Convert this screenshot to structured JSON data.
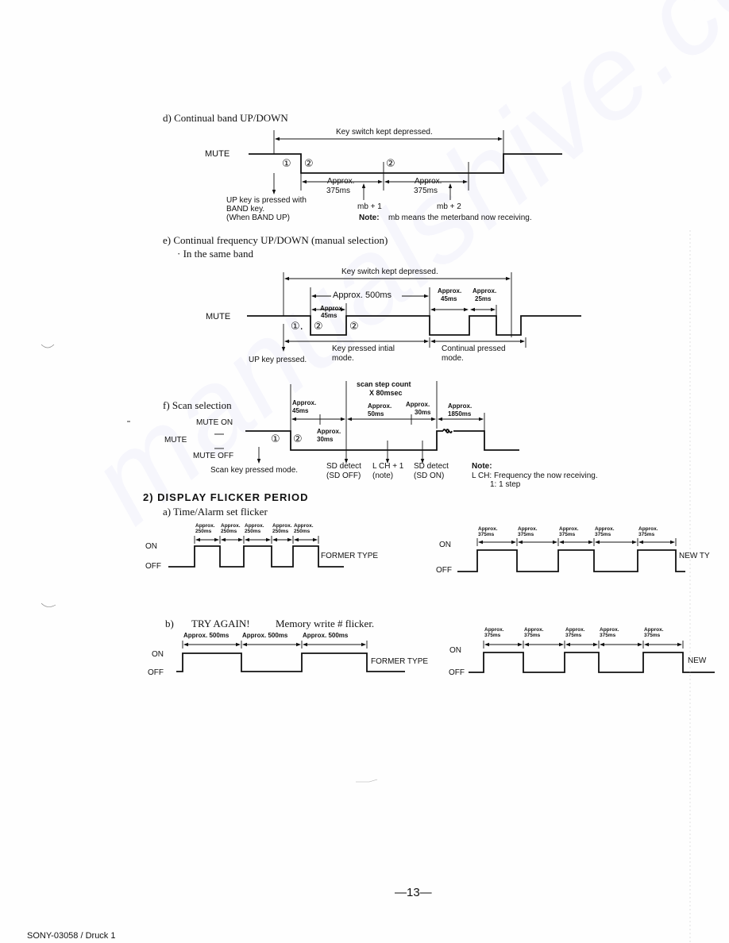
{
  "section_d": {
    "title": "d) Continual band UP/DOWN",
    "key_switch": "Key switch kept depressed.",
    "mute": "MUTE",
    "marker1": "①",
    "marker2a": "②",
    "marker2b": "②",
    "approx1_a": "Approx.",
    "approx1_b": "375ms",
    "approx2_a": "Approx.",
    "approx2_b": "375ms",
    "up_key_1": "UP key is pressed with",
    "up_key_2": "BAND key.",
    "up_key_3": "(When BAND UP)",
    "mb1": "mb + 1",
    "mb2": "mb + 2",
    "note_label": "Note:",
    "note_text": "mb means the meterband now receiving."
  },
  "section_e": {
    "title": "e) Continual frequency UP/DOWN (manual selection)",
    "bullet": "·  In the same band",
    "key_switch": "Key switch kept depressed.",
    "approx500": "Approx. 500ms",
    "approx45a_1": "Approx.",
    "approx45a_2": "45ms",
    "approx45b_1": "Approx.",
    "approx45b_2": "45ms",
    "approx25_1": "Approx.",
    "approx25_2": "25ms",
    "mute": "MUTE",
    "marker1": "①.",
    "marker2a": "②",
    "marker2b": "②",
    "initial_1": "Key pressed intial",
    "initial_2": "mode.",
    "continual_1": "Continual pressed",
    "continual_2": "mode.",
    "up_key": "UP key pressed."
  },
  "section_f": {
    "title": "f)  Scan selection",
    "scan_step_1": "scan step count",
    "scan_step_2": "X 80msec",
    "approx45_1": "Approx.",
    "approx45_2": "45ms",
    "approx50_1": "Approx.",
    "approx50_2": "50ms",
    "approx30a_1": "Approx.",
    "approx30a_2": "30ms",
    "approx1850_1": "Approx.",
    "approx1850_2": "1850ms",
    "approx30b_1": "Approx.",
    "approx30b_2": "30ms",
    "mute_on": "MUTE ON",
    "mute": "MUTE",
    "mute_off": "MUTE OFF",
    "marker1": "①",
    "marker2": "②",
    "scan_key": "Scan key pressed mode.",
    "sd_off_1": "SD detect",
    "sd_off_2": "(SD OFF)",
    "lch_1": "L CH + 1",
    "lch_2": "(note)",
    "sd_on_1": "SD detect",
    "sd_on_2": "(SD ON)",
    "note_label": "Note:",
    "note_1": "L CH: Frequency the now receiving.",
    "note_2": "1: 1 step"
  },
  "section_2": {
    "heading": "2) DISPLAY  FLICKER  PERIOD",
    "a_title": "a) Time/Alarm set flicker",
    "a_former_labels": [
      "Approx.\n250ms",
      "Approx.\n250ms",
      "Approx.\n250ms",
      "Approx.\n250ms",
      "Approx.\n250ms"
    ],
    "a_new_labels": [
      "Approx.\n375ms",
      "Approx.\n375ms",
      "Approx.\n375ms",
      "Approx.\n375ms",
      "Approx.\n375ms"
    ],
    "on": "ON",
    "off": "OFF",
    "former_type": "FORMER TYPE",
    "new_type_a": "NEW TY",
    "b_title_prefix": "b)",
    "b_title_try": "TRY AGAIN!",
    "b_title_rest": "Memory write  # flicker.",
    "b_former_labels": [
      "Approx. 500ms",
      "Approx. 500ms",
      "Approx. 500ms"
    ],
    "b_new_labels": [
      "Approx.\n375ms",
      "Approx.\n375ms",
      "Approx.\n375ms",
      "Approx.\n375ms",
      "Approx.\n375ms"
    ],
    "new_type_b": "NEW "
  },
  "page_number": "—13—",
  "footer": "SONY-03058 / Druck 1",
  "watermark": "manualshive.com"
}
